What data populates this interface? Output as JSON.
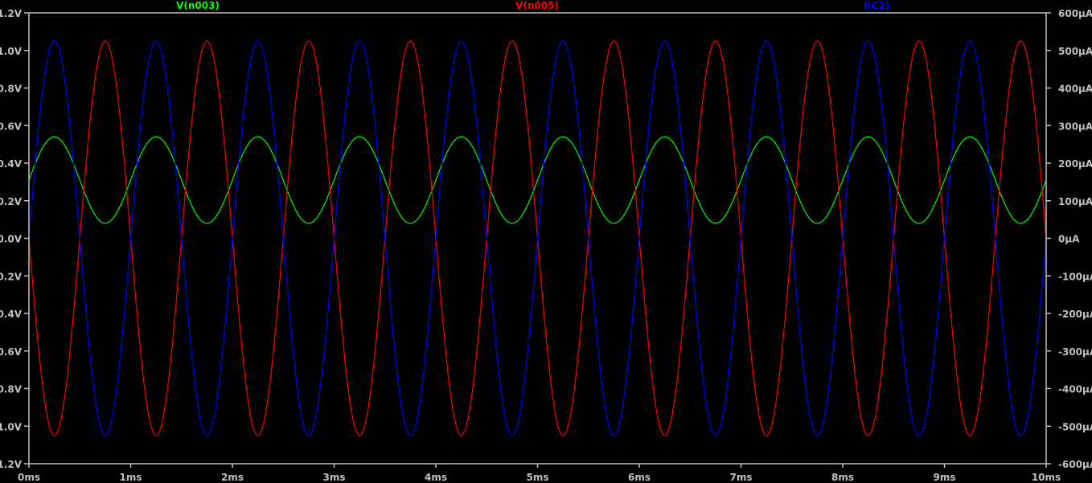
{
  "chart_data": {
    "type": "line",
    "title": "",
    "xlabel": "",
    "ylabel": "",
    "xlim_ms": [
      0,
      10
    ],
    "ylim_left_V": [
      -1.2,
      1.2
    ],
    "ylim_right_uA": [
      -600,
      600
    ],
    "grid": false,
    "legend_placement": "top",
    "x_ticks": [
      "0ms",
      "1ms",
      "2ms",
      "3ms",
      "4ms",
      "5ms",
      "6ms",
      "7ms",
      "8ms",
      "9ms",
      "10ms"
    ],
    "y_left_ticks": [
      "1.2V",
      "1.0V",
      "0.8V",
      "0.6V",
      "0.4V",
      "0.2V",
      "0.0V",
      "0.2V",
      "0.4V",
      "0.6V",
      "0.8V",
      "1.0V",
      "1.2V"
    ],
    "y_right_ticks": [
      "600µA",
      "500µA",
      "400µA",
      "300µA",
      "200µA",
      "100µA",
      "0µA",
      "-100µA",
      "-200µA",
      "-300µA",
      "-400µA",
      "-500µA",
      "-600µA"
    ],
    "series": [
      {
        "name": "V(n003)",
        "color": "#00ff00",
        "axis": "left",
        "waveform": "sine",
        "offset": 0.31,
        "amplitude": 0.23,
        "frequency_kHz": 1,
        "phase_deg": 0
      },
      {
        "name": "V(n005)",
        "color": "#ff0000",
        "axis": "left",
        "waveform": "sine",
        "offset": 0,
        "amplitude": -1.05,
        "frequency_kHz": 1,
        "phase_deg": 0
      },
      {
        "name": "I(C2)",
        "color": "#0000ff",
        "axis": "right",
        "waveform": "sine",
        "offset": 0,
        "amplitude": 525,
        "frequency_kHz": 1,
        "phase_deg": 0
      }
    ]
  },
  "colors": {
    "axis": "#c0c0c0",
    "background": "#000000"
  }
}
